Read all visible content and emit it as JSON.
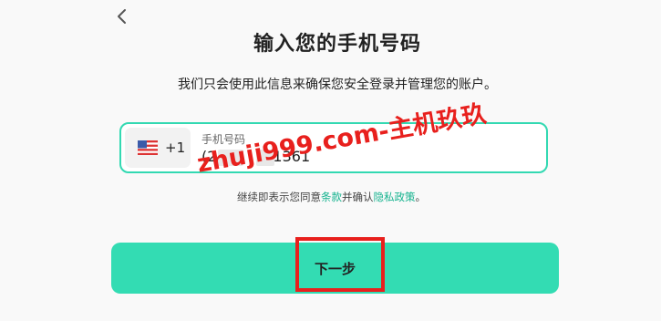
{
  "header": {
    "back_icon": "chevron-left-icon",
    "title": "输入您的手机号码",
    "subtitle": "我们只会使用此信息来确保您安全登录并管理您的账户。"
  },
  "phone": {
    "country_flag": "us-flag-icon",
    "country_code": "+1",
    "label": "手机号码",
    "value_prefix": "(2",
    "value_suffix": "1361"
  },
  "watermark": "zhuji999.com-主机玖玖",
  "consent": {
    "prefix": "继续即表示您同意",
    "terms_link": "条款",
    "middle": "并确认",
    "privacy_link": "隐私政策",
    "suffix": "。"
  },
  "next_button": {
    "label": "下一步",
    "color": "#33dcb3"
  },
  "colors": {
    "accent": "#33d9b2",
    "highlight_red": "#e8201d"
  }
}
